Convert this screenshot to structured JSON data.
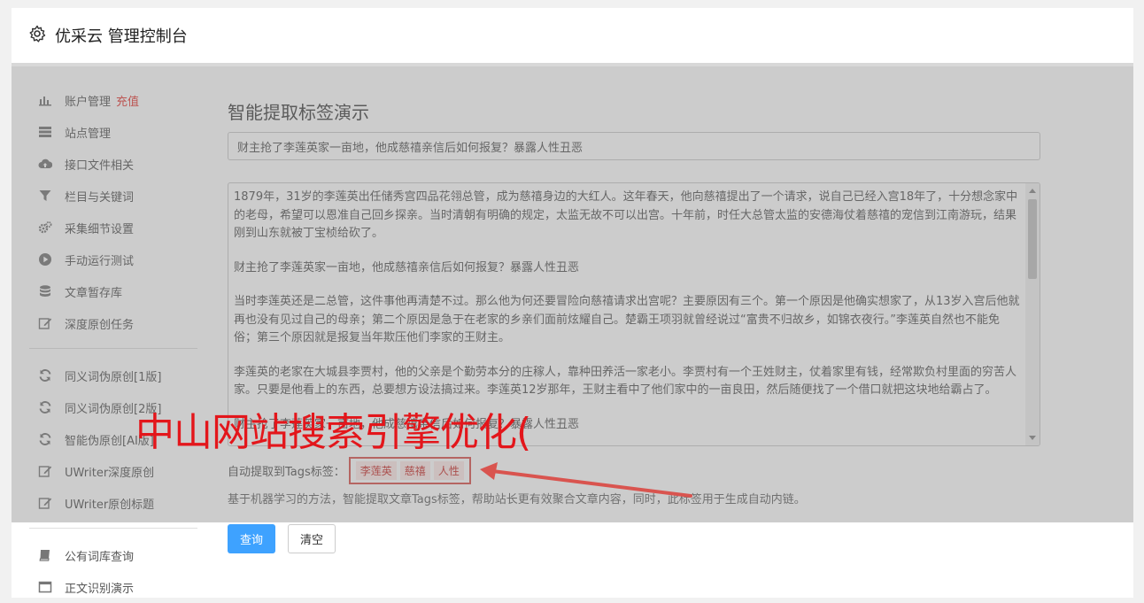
{
  "header": {
    "title": "优采云 管理控制台"
  },
  "sidebar": {
    "items": [
      {
        "label": "账户管理",
        "badge": "充值",
        "icon": "bar-chart-icon"
      },
      {
        "label": "站点管理",
        "icon": "server-icon"
      },
      {
        "label": "接口文件相关",
        "icon": "cloud-upload-icon"
      },
      {
        "label": "栏目与关键词",
        "icon": "filter-icon"
      },
      {
        "label": "采集细节设置",
        "icon": "gears-icon"
      },
      {
        "label": "手动运行测试",
        "icon": "play-icon"
      },
      {
        "label": "文章暂存库",
        "icon": "database-icon"
      },
      {
        "label": "深度原创任务",
        "icon": "edit-icon"
      }
    ],
    "items2": [
      {
        "label": "同义词伪原创[1版]",
        "icon": "refresh-icon"
      },
      {
        "label": "同义词伪原创[2版]",
        "icon": "refresh-icon"
      },
      {
        "label": "智能伪原创[AI版]",
        "icon": "refresh-icon"
      },
      {
        "label": "UWriter深度原创",
        "icon": "edit-icon"
      },
      {
        "label": "UWriter原创标题",
        "icon": "edit-icon"
      }
    ],
    "items3": [
      {
        "label": "公有词库查询",
        "icon": "book-icon"
      },
      {
        "label": "正文识别演示",
        "icon": "window-icon"
      }
    ]
  },
  "main": {
    "page_title": "智能提取标签演示",
    "title_value": "财主抢了李莲英家一亩地，他成慈禧亲信后如何报复？暴露人性丑恶",
    "content_paragraphs": [
      "1879年，31岁的李莲英出任储秀宫四品花翎总管，成为慈禧身边的大红人。这年春天，他向慈禧提出了一个请求，说自己已经入宫18年了，十分想念家中的老母，希望可以恩准自己回乡探亲。当时清朝有明确的规定，太监无故不可以出宫。十年前，时任大总管太监的安德海仗着慈禧的宠信到江南游玩，结果刚到山东就被丁宝桢给砍了。",
      "财主抢了李莲英家一亩地，他成慈禧亲信后如何报复？暴露人性丑恶",
      "当时李莲英还是二总管，这件事他再清楚不过。那么他为何还要冒险向慈禧请求出宫呢？主要原因有三个。第一个原因是他确实想家了，从13岁入宫后他就再也没有见过自己的母亲；第二个原因是急于在老家的乡亲们面前炫耀自己。楚霸王项羽就曾经说过“富贵不归故乡，如锦衣夜行。”李莲英自然也不能免俗；第三个原因就是报复当年欺压他们李家的王财主。",
      "李莲英的老家在大城县李贾村，他的父亲是个勤劳本分的庄稼人，靠种田养活一家老小。李贾村有一个王姓财主，仗着家里有钱，经常欺负村里面的穷苦人家。只要是他看上的东西，总要想方设法搞过来。李莲英12岁那年，王财主看中了他们家中的一亩良田，然后随便找了一个借口就把这块地给霸占了。",
      "财主抢了李莲英家一亩地，他成慈禧亲信后如何报复？暴露人性丑恶"
    ],
    "tags_label": "自动提取到Tags标签：",
    "tags": [
      "李莲英",
      "慈禧",
      "人性"
    ],
    "description": "基于机器学习的方法，智能提取文章Tags标签，帮助站长更有效聚合文章内容，同时，此标签用于生成自动内链。",
    "query_button": "查询",
    "clear_button": "清空"
  },
  "watermark": "中山网站搜索引擎优化(",
  "colors": {
    "accent": "#3ea2ff",
    "badge": "#e53935",
    "watermark": "#e3161b"
  }
}
